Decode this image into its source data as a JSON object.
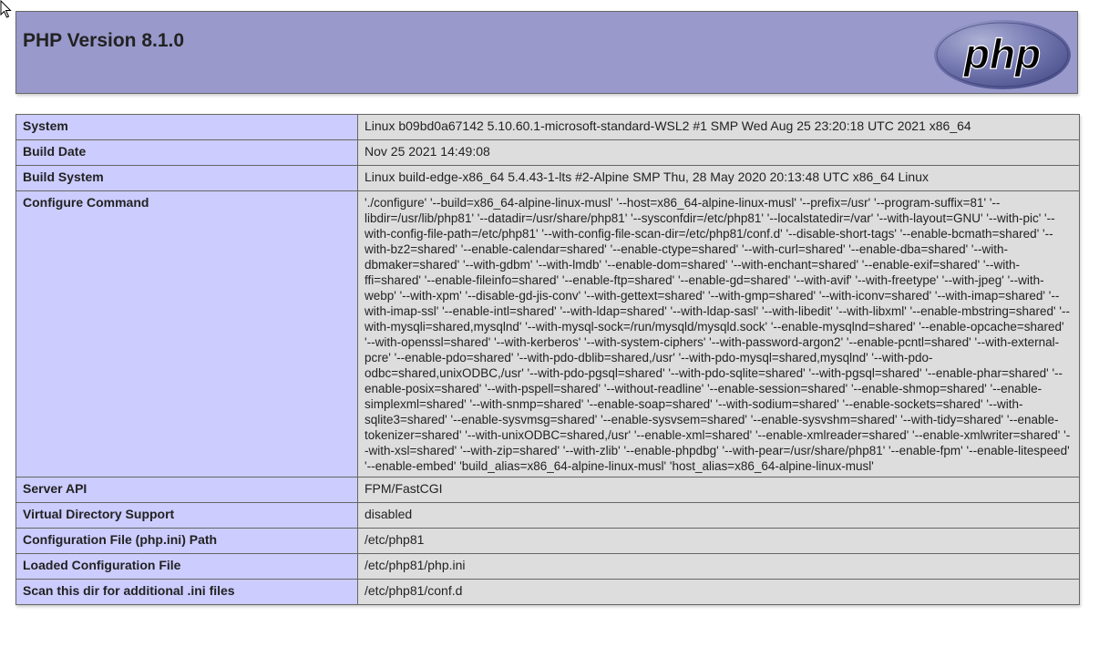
{
  "header": {
    "title": "PHP Version 8.1.0",
    "logo_text": "php"
  },
  "rows": [
    {
      "label": "System",
      "value": "Linux b09bd0a67142 5.10.60.1-microsoft-standard-WSL2 #1 SMP Wed Aug 25 23:20:18 UTC 2021 x86_64"
    },
    {
      "label": "Build Date",
      "value": "Nov 25 2021 14:49:08"
    },
    {
      "label": "Build System",
      "value": "Linux build-edge-x86_64 5.4.43-1-lts #2-Alpine SMP Thu, 28 May 2020 20:13:48 UTC x86_64 Linux"
    },
    {
      "label": "Configure Command",
      "value": "'./configure' '--build=x86_64-alpine-linux-musl' '--host=x86_64-alpine-linux-musl' '--prefix=/usr' '--program-suffix=81' '--libdir=/usr/lib/php81' '--datadir=/usr/share/php81' '--sysconfdir=/etc/php81' '--localstatedir=/var' '--with-layout=GNU' '--with-pic' '--with-config-file-path=/etc/php81' '--with-config-file-scan-dir=/etc/php81/conf.d' '--disable-short-tags' '--enable-bcmath=shared' '--with-bz2=shared' '--enable-calendar=shared' '--enable-ctype=shared' '--with-curl=shared' '--enable-dba=shared' '--with-dbmaker=shared' '--with-gdbm' '--with-lmdb' '--enable-dom=shared' '--with-enchant=shared' '--enable-exif=shared' '--with-ffi=shared' '--enable-fileinfo=shared' '--enable-ftp=shared' '--enable-gd=shared' '--with-avif' '--with-freetype' '--with-jpeg' '--with-webp' '--with-xpm' '--disable-gd-jis-conv' '--with-gettext=shared' '--with-gmp=shared' '--with-iconv=shared' '--with-imap=shared' '--with-imap-ssl' '--enable-intl=shared' '--with-ldap=shared' '--with-ldap-sasl' '--with-libedit' '--with-libxml' '--enable-mbstring=shared' '--with-mysqli=shared,mysqlnd' '--with-mysql-sock=/run/mysqld/mysqld.sock' '--enable-mysqlnd=shared' '--enable-opcache=shared' '--with-openssl=shared' '--with-kerberos' '--with-system-ciphers' '--with-password-argon2' '--enable-pcntl=shared' '--with-external-pcre' '--enable-pdo=shared' '--with-pdo-dblib=shared,/usr' '--with-pdo-mysql=shared,mysqlnd' '--with-pdo-odbc=shared,unixODBC,/usr' '--with-pdo-pgsql=shared' '--with-pdo-sqlite=shared' '--with-pgsql=shared' '--enable-phar=shared' '--enable-posix=shared' '--with-pspell=shared' '--without-readline' '--enable-session=shared' '--enable-shmop=shared' '--enable-simplexml=shared' '--with-snmp=shared' '--enable-soap=shared' '--with-sodium=shared' '--enable-sockets=shared' '--with-sqlite3=shared' '--enable-sysvmsg=shared' '--enable-sysvsem=shared' '--enable-sysvshm=shared' '--with-tidy=shared' '--enable-tokenizer=shared' '--with-unixODBC=shared,/usr' '--enable-xml=shared' '--enable-xmlreader=shared' '--enable-xmlwriter=shared' '--with-xsl=shared' '--with-zip=shared' '--with-zlib' '--enable-phpdbg' '--with-pear=/usr/share/php81' '--enable-fpm' '--enable-litespeed' '--enable-embed' 'build_alias=x86_64-alpine-linux-musl' 'host_alias=x86_64-alpine-linux-musl'"
    },
    {
      "label": "Server API",
      "value": "FPM/FastCGI"
    },
    {
      "label": "Virtual Directory Support",
      "value": "disabled"
    },
    {
      "label": "Configuration File (php.ini) Path",
      "value": "/etc/php81"
    },
    {
      "label": "Loaded Configuration File",
      "value": "/etc/php81/php.ini"
    },
    {
      "label": "Scan this dir for additional .ini files",
      "value": "/etc/php81/conf.d"
    }
  ]
}
